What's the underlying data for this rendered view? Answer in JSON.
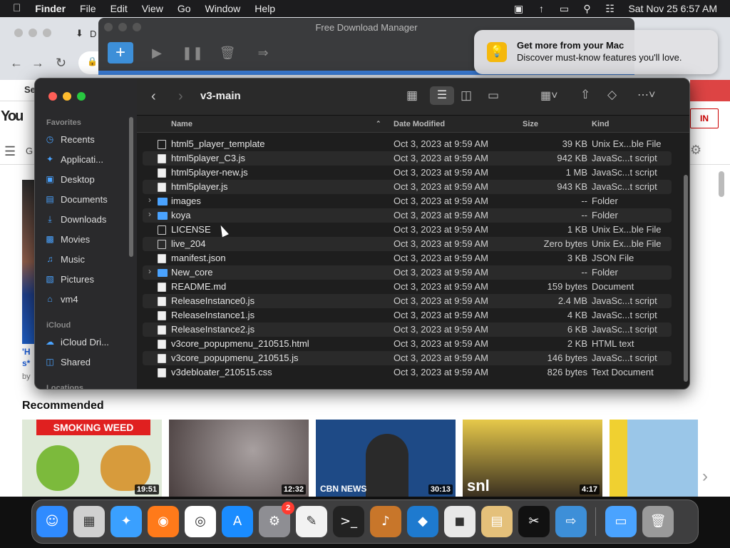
{
  "menubar": {
    "apple": "",
    "app": "Finder",
    "items": [
      "File",
      "Edit",
      "View",
      "Go",
      "Window",
      "Help"
    ],
    "clock": "Sat Nov 25  6:57 AM"
  },
  "browser": {
    "tab_partial": "D",
    "yt_logo": "You",
    "signin": "IN",
    "partial_g": "G",
    "partial_se": "Se",
    "side_text": "'H",
    "side_text2": "s*",
    "side_text3": "by"
  },
  "fdm": {
    "title": "Free Download Manager"
  },
  "notification": {
    "title": "Get more from your Mac",
    "body": "Discover must-know features you'll love."
  },
  "finder": {
    "title": "v3-main",
    "sidebar": {
      "favorites_label": "Favorites",
      "favorites": [
        "Recents",
        "Applicati...",
        "Desktop",
        "Documents",
        "Downloads",
        "Movies",
        "Music",
        "Pictures",
        "vm4"
      ],
      "icloud_label": "iCloud",
      "icloud": [
        "iCloud Dri...",
        "Shared"
      ],
      "locations_label": "Locations"
    },
    "columns": {
      "name": "Name",
      "date": "Date Modified",
      "size": "Size",
      "kind": "Kind"
    },
    "files": [
      {
        "name": "html5_player_template",
        "date": "Oct 3, 2023 at 9:59 AM",
        "size": "39 KB",
        "kind": "Unix Ex...ble File",
        "type": "exe"
      },
      {
        "name": "html5player_C3.js",
        "date": "Oct 3, 2023 at 9:59 AM",
        "size": "942 KB",
        "kind": "JavaSc...t script",
        "type": "doc"
      },
      {
        "name": "html5player-new.js",
        "date": "Oct 3, 2023 at 9:59 AM",
        "size": "1 MB",
        "kind": "JavaSc...t script",
        "type": "doc"
      },
      {
        "name": "html5player.js",
        "date": "Oct 3, 2023 at 9:59 AM",
        "size": "943 KB",
        "kind": "JavaSc...t script",
        "type": "doc"
      },
      {
        "name": "images",
        "date": "Oct 3, 2023 at 9:59 AM",
        "size": "--",
        "kind": "Folder",
        "type": "folder"
      },
      {
        "name": "koya",
        "date": "Oct 3, 2023 at 9:59 AM",
        "size": "--",
        "kind": "Folder",
        "type": "folder"
      },
      {
        "name": "LICENSE",
        "date": "Oct 3, 2023 at 9:59 AM",
        "size": "1 KB",
        "kind": "Unix Ex...ble File",
        "type": "exe"
      },
      {
        "name": "live_204",
        "date": "Oct 3, 2023 at 9:59 AM",
        "size": "Zero bytes",
        "kind": "Unix Ex...ble File",
        "type": "exe"
      },
      {
        "name": "manifest.json",
        "date": "Oct 3, 2023 at 9:59 AM",
        "size": "3 KB",
        "kind": "JSON File",
        "type": "doc"
      },
      {
        "name": "New_core",
        "date": "Oct 3, 2023 at 9:59 AM",
        "size": "--",
        "kind": "Folder",
        "type": "folder"
      },
      {
        "name": "README.md",
        "date": "Oct 3, 2023 at 9:59 AM",
        "size": "159 bytes",
        "kind": "Document",
        "type": "doc"
      },
      {
        "name": "ReleaseInstance0.js",
        "date": "Oct 3, 2023 at 9:59 AM",
        "size": "2.4 MB",
        "kind": "JavaSc...t script",
        "type": "doc"
      },
      {
        "name": "ReleaseInstance1.js",
        "date": "Oct 3, 2023 at 9:59 AM",
        "size": "4 KB",
        "kind": "JavaSc...t script",
        "type": "doc"
      },
      {
        "name": "ReleaseInstance2.js",
        "date": "Oct 3, 2023 at 9:59 AM",
        "size": "6 KB",
        "kind": "JavaSc...t script",
        "type": "doc"
      },
      {
        "name": "v3core_popupmenu_210515.html",
        "date": "Oct 3, 2023 at 9:59 AM",
        "size": "2 KB",
        "kind": "HTML text",
        "type": "doc"
      },
      {
        "name": "v3core_popupmenu_210515.js",
        "date": "Oct 3, 2023 at 9:59 AM",
        "size": "146 bytes",
        "kind": "JavaSc...t script",
        "type": "doc"
      },
      {
        "name": "v3debloater_210515.css",
        "date": "Oct 3, 2023 at 9:59 AM",
        "size": "826 bytes",
        "kind": "Text Document",
        "type": "doc"
      }
    ]
  },
  "youtube": {
    "recommended": "Recommended",
    "videos": [
      {
        "duration": "19:51",
        "overlay": "SMOKING WEED",
        "color": "#dfe9d8"
      },
      {
        "duration": "12:32",
        "overlay": "",
        "color": "#6b5a58"
      },
      {
        "duration": "30:13",
        "overlay": "CBN NEWS",
        "color": "#1e4a86"
      },
      {
        "duration": "4:17",
        "overlay": "snl",
        "color": "#c8a335"
      },
      {
        "duration": "",
        "overlay": "",
        "color": "#6aa7d8"
      }
    ]
  },
  "dock": {
    "badge": "2",
    "apps": [
      "finder-icon",
      "launchpad-icon",
      "safari-icon",
      "firefox-icon",
      "chrome-icon",
      "app-store-icon",
      "system-settings-icon",
      "textedit-icon",
      "terminal-icon",
      "garageband-icon",
      "vscode-icon",
      "roblox-icon",
      "archive-utility-icon",
      "capcut-icon",
      "free-download-manager-icon",
      "downloads-folder-icon",
      "trash-icon"
    ]
  }
}
